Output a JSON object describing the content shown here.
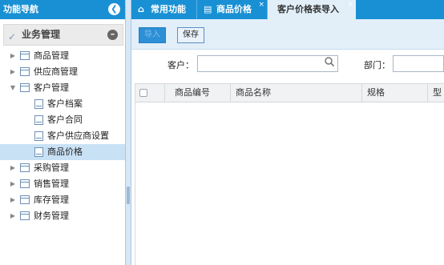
{
  "left_nav": {
    "title": "功能导航",
    "collapse_icon": "chevron-left-icon",
    "group": {
      "label": "业务管理",
      "icon": "tag-icon"
    },
    "tree": [
      {
        "label": "商品管理",
        "level": 0,
        "expanded": false
      },
      {
        "label": "供应商管理",
        "level": 0,
        "expanded": false
      },
      {
        "label": "客户管理",
        "level": 0,
        "expanded": true
      },
      {
        "label": "客户档案",
        "level": 1
      },
      {
        "label": "客户合同",
        "level": 1
      },
      {
        "label": "客户供应商设置",
        "level": 1
      },
      {
        "label": "商品价格",
        "level": 1,
        "selected": true
      },
      {
        "label": "采购管理",
        "level": 0,
        "expanded": false
      },
      {
        "label": "销售管理",
        "level": 0,
        "expanded": false
      },
      {
        "label": "库存管理",
        "level": 0,
        "expanded": false
      },
      {
        "label": "财务管理",
        "level": 0,
        "expanded": false
      }
    ]
  },
  "tabs": [
    {
      "label": "常用功能",
      "icon": "home-icon",
      "active": false,
      "closable": false
    },
    {
      "label": "商品价格",
      "icon": "document-icon",
      "active": false,
      "closable": true
    },
    {
      "label": "客户价格表导入",
      "active": true,
      "closable": true
    }
  ],
  "toolbar": {
    "import_label": "导入",
    "save_label": "保存"
  },
  "search": {
    "customer_label": "客户：",
    "customer_value": "",
    "department_label": "部门：",
    "department_value": ""
  },
  "grid": {
    "columns": [
      "商品编号",
      "商品名称",
      "规格",
      "型"
    ]
  },
  "colors": {
    "header_blue": "#1a90d4",
    "toolbar_bg": "#e2eff9",
    "selected_row": "#c9e1f5"
  }
}
